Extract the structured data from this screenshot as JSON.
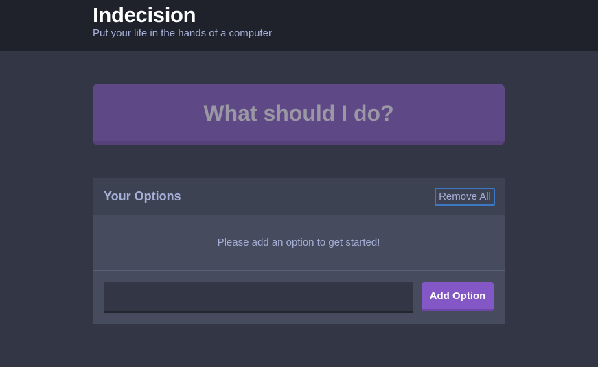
{
  "header": {
    "title": "Indecision",
    "subtitle": "Put your life in the hands of a computer"
  },
  "action": {
    "label": "What should I do?",
    "disabled": true
  },
  "options_widget": {
    "title": "Your Options",
    "remove_all_label": "Remove All",
    "empty_message": "Please add an option to get started!",
    "options": []
  },
  "add_option_form": {
    "input_value": "",
    "input_placeholder": "",
    "submit_label": "Add Option"
  },
  "colors": {
    "page_background": "#333745",
    "header_background": "#20222b",
    "action_button": "#5f4886",
    "accent_purple": "#8357c5",
    "text_light_purple": "#a5afd7",
    "focus_blue": "#3d78c4"
  }
}
